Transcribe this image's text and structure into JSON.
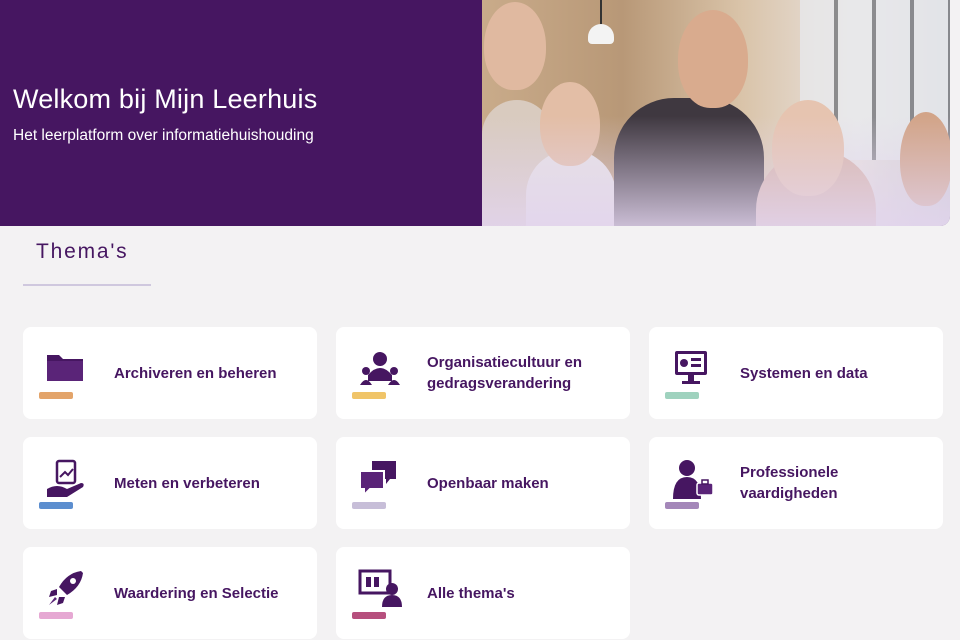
{
  "hero": {
    "title": "Welkom bij Mijn Leerhuis",
    "subtitle": "Het leerplatform over informatiehuishouding",
    "background_color": "#461661"
  },
  "section": {
    "title": "Thema's"
  },
  "themes": [
    {
      "label": "Archiveren en beheren",
      "icon": "folder-icon",
      "accent": "#e3a46a"
    },
    {
      "label": "Organisatiecultuur en gedragsverandering",
      "icon": "group-people-icon",
      "accent": "#f0c468"
    },
    {
      "label": "Systemen en data",
      "icon": "monitor-dashboard-icon",
      "accent": "#9fd2be"
    },
    {
      "label": "Meten en verbeteren",
      "icon": "hand-report-icon",
      "accent": "#5c8ecf"
    },
    {
      "label": "Openbaar maken",
      "icon": "chat-bubbles-icon",
      "accent": "#c7bed8"
    },
    {
      "label": "Professionele vaardigheden",
      "icon": "professional-briefcase-icon",
      "accent": "#a487b9"
    },
    {
      "label": "Waardering en Selectie",
      "icon": "rocket-icon",
      "accent": "#e6a8d3"
    },
    {
      "label": "Alle thema's",
      "icon": "presentation-person-icon",
      "accent": "#b64f7d"
    }
  ]
}
